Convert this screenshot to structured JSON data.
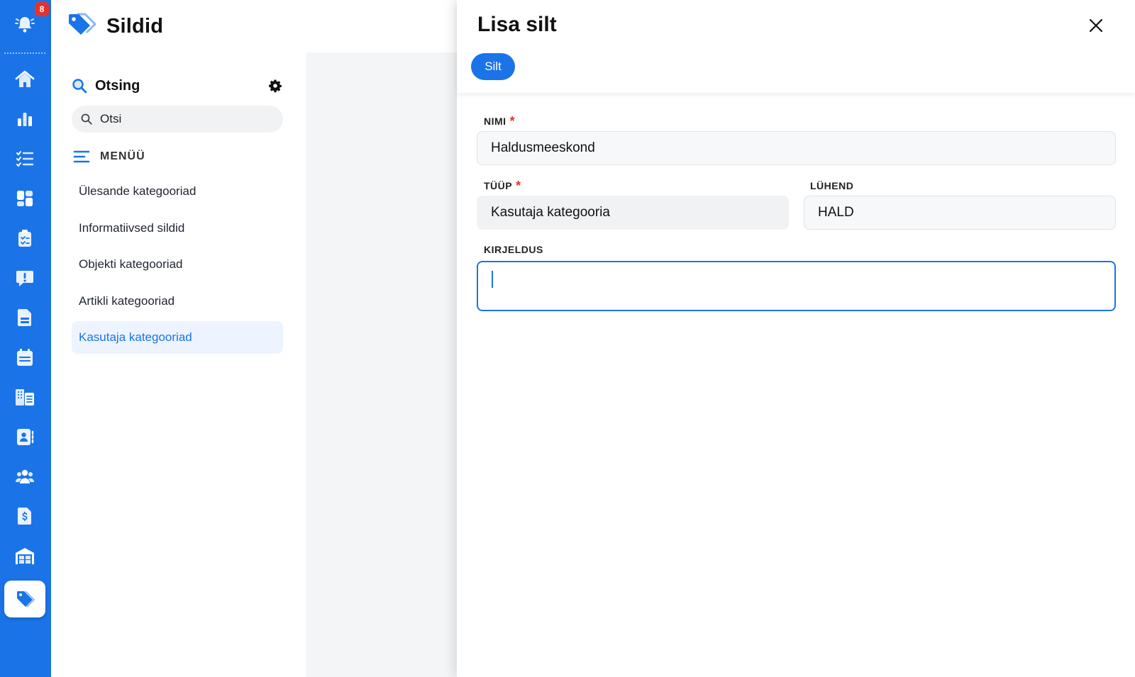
{
  "app": {
    "title": "Sildid",
    "notification_count": "8"
  },
  "rail": {
    "items": [
      {
        "icon": "home-icon"
      },
      {
        "icon": "bar-chart-icon"
      },
      {
        "icon": "checklist-icon"
      },
      {
        "icon": "dashboard-icon"
      },
      {
        "icon": "clipboard-check-icon"
      },
      {
        "icon": "alert-message-icon"
      },
      {
        "icon": "document-icon"
      },
      {
        "icon": "calendar-icon"
      },
      {
        "icon": "buildings-list-icon"
      },
      {
        "icon": "contact-card-icon"
      },
      {
        "icon": "users-group-icon"
      },
      {
        "icon": "invoice-icon"
      },
      {
        "icon": "warehouse-icon"
      },
      {
        "icon": "tag-icon",
        "active": true
      }
    ]
  },
  "sidebar": {
    "search_label": "Otsing",
    "search_placeholder": "Otsi",
    "menu_label": "MENÜÜ",
    "items": [
      {
        "label": "Ülesande kategooriad"
      },
      {
        "label": "Informatiivsed sildid"
      },
      {
        "label": "Objekti kategooriad"
      },
      {
        "label": "Artikli kategooriad"
      },
      {
        "label": "Kasutaja kategooriad",
        "active": true
      }
    ]
  },
  "panel": {
    "title": "Lisa silt",
    "tab_label": "Silt",
    "fields": {
      "name": {
        "label": "NIMI",
        "required": "*",
        "value": "Haldusmeeskond"
      },
      "type": {
        "label": "TÜÜP",
        "required": "*",
        "value": "Kasutaja kategooria"
      },
      "abbr": {
        "label": "LÜHEND",
        "value": "HALD"
      },
      "description": {
        "label": "KIRJELDUS",
        "value": ""
      }
    }
  },
  "colors": {
    "accent": "#1a74e8",
    "required": "#e5322d",
    "active_bg": "#eef4ff"
  }
}
